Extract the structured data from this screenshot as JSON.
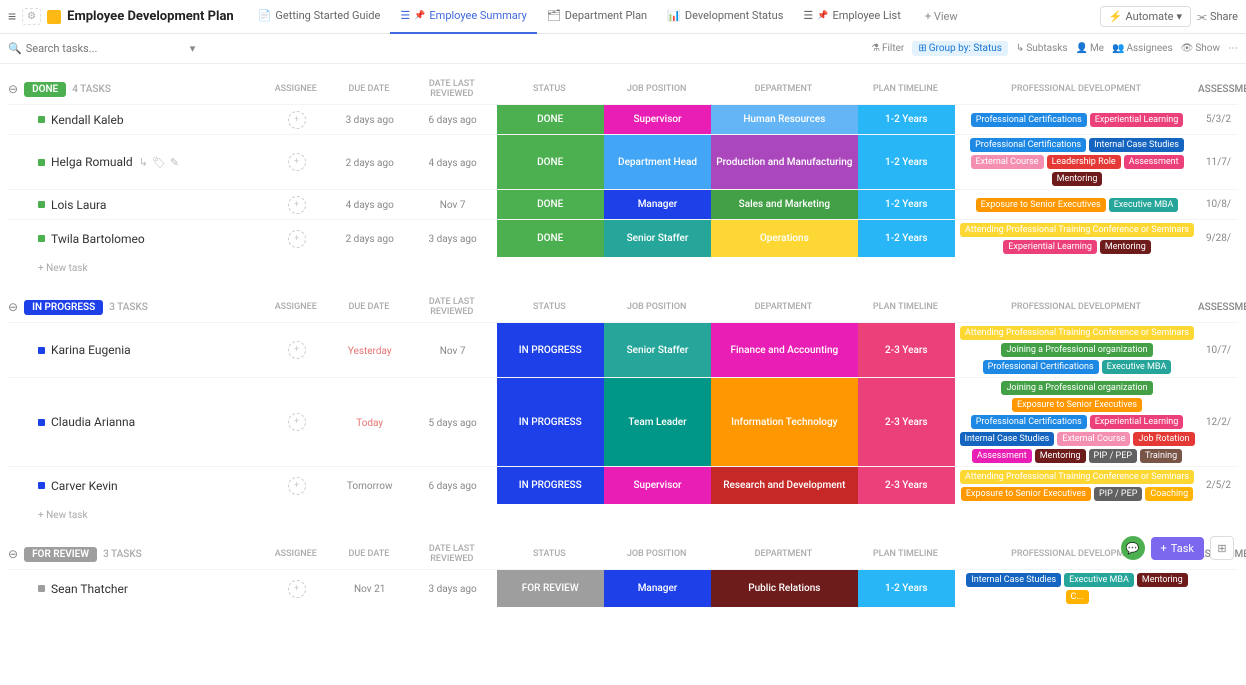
{
  "header": {
    "title": "Employee Development Plan",
    "automate": "Automate",
    "share": "Share",
    "addView": "+ View"
  },
  "tabs": [
    {
      "label": "Getting Started Guide",
      "icon": "📄",
      "pin": false
    },
    {
      "label": "Employee Summary",
      "icon": "☰",
      "pin": true,
      "active": true
    },
    {
      "label": "Department Plan",
      "icon": "🗂",
      "pin": false
    },
    {
      "label": "Development Status",
      "icon": "📊",
      "pin": false
    },
    {
      "label": "Employee List",
      "icon": "☰",
      "pin": true
    }
  ],
  "toolbar": {
    "searchPlaceholder": "Search tasks...",
    "filter": "Filter",
    "group": "Group by: Status",
    "subtasks": "Subtasks",
    "me": "Me",
    "assignees": "Assignees",
    "show": "Show"
  },
  "columns": {
    "assignee": "ASSIGNEE",
    "due": "DUE DATE",
    "reviewed": "DATE LAST REVIEWED",
    "status": "STATUS",
    "job": "JOB POSITION",
    "dept": "DEPARTMENT",
    "plan": "PLAN TIMELINE",
    "prof": "PROFESSIONAL DEVELOPMENT",
    "assess": "ASSESSMENT"
  },
  "newtask": "+ New task",
  "fab": {
    "task": "Task"
  },
  "groups": [
    {
      "name": "DONE",
      "color": "#4CAF50",
      "count": "4 TASKS",
      "rows": [
        {
          "name": "Kendall Kaleb",
          "dot": "#4CAF50",
          "due": "3 days ago",
          "reviewed": "6 days ago",
          "status": {
            "t": "DONE",
            "c": "#4CAF50"
          },
          "job": {
            "t": "Supervisor",
            "c": "#E91EB4"
          },
          "dept": {
            "t": "Human Resources",
            "c": "#64B5F6"
          },
          "plan": {
            "t": "1-2 Years",
            "c": "#29B6F6"
          },
          "prof": [
            {
              "t": "Professional Certifications",
              "c": "#1E88E5"
            },
            {
              "t": "Experiential Learning",
              "c": "#EC407A"
            }
          ],
          "assess": "5/3/2"
        },
        {
          "name": "Helga Romuald",
          "dot": "#4CAF50",
          "due": "2 days ago",
          "reviewed": "4 days ago",
          "hover": true,
          "status": {
            "t": "DONE",
            "c": "#4CAF50"
          },
          "job": {
            "t": "Department Head",
            "c": "#42A5F5"
          },
          "dept": {
            "t": "Production and Manufacturing",
            "c": "#AB47BC"
          },
          "plan": {
            "t": "1-2 Years",
            "c": "#29B6F6"
          },
          "prof": [
            {
              "t": "Professional Certifications",
              "c": "#1E88E5"
            },
            {
              "t": "Internal Case Studies",
              "c": "#1565C0"
            },
            {
              "t": "External Course",
              "c": "#F48FB1"
            },
            {
              "t": "Leadership Role",
              "c": "#E53935"
            },
            {
              "t": "Assessment",
              "c": "#EC407A"
            },
            {
              "t": "Mentoring",
              "c": "#6D1B1B"
            }
          ],
          "assess": "11/7/"
        },
        {
          "name": "Lois Laura",
          "dot": "#4CAF50",
          "due": "4 days ago",
          "reviewed": "Nov 7",
          "status": {
            "t": "DONE",
            "c": "#4CAF50"
          },
          "job": {
            "t": "Manager",
            "c": "#1E40E8"
          },
          "dept": {
            "t": "Sales and Marketing",
            "c": "#43A047"
          },
          "plan": {
            "t": "1-2 Years",
            "c": "#29B6F6"
          },
          "prof": [
            {
              "t": "Exposure to Senior Executives",
              "c": "#FF9800"
            },
            {
              "t": "Executive MBA",
              "c": "#26A69A"
            }
          ],
          "assess": "10/8/"
        },
        {
          "name": "Twila Bartolomeo",
          "dot": "#4CAF50",
          "due": "2 days ago",
          "reviewed": "3 days ago",
          "status": {
            "t": "DONE",
            "c": "#4CAF50"
          },
          "job": {
            "t": "Senior Staffer",
            "c": "#26A69A"
          },
          "dept": {
            "t": "Operations",
            "c": "#FDD835"
          },
          "plan": {
            "t": "1-2 Years",
            "c": "#29B6F6"
          },
          "prof": [
            {
              "t": "Attending Professional Training Conference or Seminars",
              "c": "#FDD835"
            },
            {
              "t": "Experiential Learning",
              "c": "#EC407A"
            },
            {
              "t": "Mentoring",
              "c": "#6D1B1B"
            }
          ],
          "assess": "9/28/"
        }
      ]
    },
    {
      "name": "IN PROGRESS",
      "color": "#1E40E8",
      "count": "3 TASKS",
      "rows": [
        {
          "name": "Karina Eugenia",
          "dot": "#1E40E8",
          "due": "Yesterday",
          "dueWarn": true,
          "reviewed": "Nov 7",
          "status": {
            "t": "IN PROGRESS",
            "c": "#1E40E8"
          },
          "job": {
            "t": "Senior Staffer",
            "c": "#26A69A"
          },
          "dept": {
            "t": "Finance and Accounting",
            "c": "#E91EB4"
          },
          "plan": {
            "t": "2-3 Years",
            "c": "#EC407A"
          },
          "prof": [
            {
              "t": "Attending Professional Training Conference or Seminars",
              "c": "#FDD835"
            },
            {
              "t": "Joining a Professional organization",
              "c": "#43A047"
            },
            {
              "t": "Professional Certifications",
              "c": "#1E88E5"
            },
            {
              "t": "Executive MBA",
              "c": "#26A69A"
            }
          ],
          "assess": "10/7/"
        },
        {
          "name": "Claudia Arianna",
          "dot": "#1E40E8",
          "due": "Today",
          "dueWarn": true,
          "reviewed": "5 days ago",
          "status": {
            "t": "IN PROGRESS",
            "c": "#1E40E8"
          },
          "job": {
            "t": "Team Leader",
            "c": "#009688"
          },
          "dept": {
            "t": "Information Technology",
            "c": "#FF9800"
          },
          "plan": {
            "t": "2-3 Years",
            "c": "#EC407A"
          },
          "prof": [
            {
              "t": "Joining a Professional organization",
              "c": "#43A047"
            },
            {
              "t": "Exposure to Senior Executives",
              "c": "#FF9800"
            },
            {
              "t": "Professional Certifications",
              "c": "#1E88E5"
            },
            {
              "t": "Experiential Learning",
              "c": "#EC407A"
            },
            {
              "t": "Internal Case Studies",
              "c": "#1565C0"
            },
            {
              "t": "External Course",
              "c": "#F48FB1"
            },
            {
              "t": "Job Rotation",
              "c": "#E53935"
            },
            {
              "t": "Assessment",
              "c": "#E91EB4"
            },
            {
              "t": "Mentoring",
              "c": "#6D1B1B"
            },
            {
              "t": "PIP / PEP",
              "c": "#616161"
            },
            {
              "t": "Training",
              "c": "#795548"
            }
          ],
          "assess": "12/2/"
        },
        {
          "name": "Carver Kevin",
          "dot": "#1E40E8",
          "due": "Tomorrow",
          "reviewed": "6 days ago",
          "status": {
            "t": "IN PROGRESS",
            "c": "#1E40E8"
          },
          "job": {
            "t": "Supervisor",
            "c": "#E91EB4"
          },
          "dept": {
            "t": "Research and Development",
            "c": "#C62828"
          },
          "plan": {
            "t": "2-3 Years",
            "c": "#EC407A"
          },
          "prof": [
            {
              "t": "Attending Professional Training Conference or Seminars",
              "c": "#FDD835"
            },
            {
              "t": "Exposure to Senior Executives",
              "c": "#FF9800"
            },
            {
              "t": "PIP / PEP",
              "c": "#616161"
            },
            {
              "t": "Coaching",
              "c": "#FFB300"
            }
          ],
          "assess": "2/5/2"
        }
      ]
    },
    {
      "name": "FOR REVIEW",
      "color": "#9E9E9E",
      "count": "3 TASKS",
      "rows": [
        {
          "name": "Sean Thatcher",
          "dot": "#9E9E9E",
          "due": "Nov 21",
          "reviewed": "3 days ago",
          "status": {
            "t": "FOR REVIEW",
            "c": "#9E9E9E"
          },
          "job": {
            "t": "Manager",
            "c": "#1E40E8"
          },
          "dept": {
            "t": "Public Relations",
            "c": "#6D1B1B"
          },
          "plan": {
            "t": "1-2 Years",
            "c": "#29B6F6"
          },
          "prof": [
            {
              "t": "Internal Case Studies",
              "c": "#1565C0"
            },
            {
              "t": "Executive MBA",
              "c": "#26A69A"
            },
            {
              "t": "Mentoring",
              "c": "#6D1B1B"
            },
            {
              "t": "C...",
              "c": "#FFB300"
            }
          ],
          "assess": ""
        }
      ]
    }
  ]
}
